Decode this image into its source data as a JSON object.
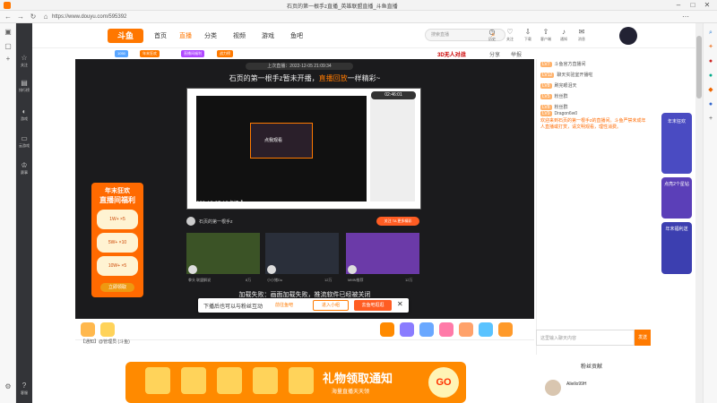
{
  "browser": {
    "title": "石页的第一根手z直播_英雄联盟直播_斗鱼直播",
    "url": "https://www.douyu.com/595392"
  },
  "site_sidebar": {
    "items": [
      {
        "icon": "star-icon",
        "label": "关注"
      },
      {
        "icon": "rank-icon",
        "label": "排行榜"
      },
      {
        "icon": "game-icon",
        "label": "游戏"
      },
      {
        "icon": "ticket-icon",
        "label": "云游戏"
      },
      {
        "icon": "trophy-icon",
        "label": "赛事"
      },
      {
        "icon": "help-icon",
        "label": "客服"
      }
    ]
  },
  "topnav": {
    "logo": "斗鱼",
    "links": [
      "首页",
      "直播",
      "分类",
      "视频",
      "游戏",
      "鱼吧"
    ],
    "active": "直播",
    "search_placeholder": "搜索直播",
    "tools": [
      {
        "icon": "history-icon",
        "label": "历史"
      },
      {
        "icon": "follow-icon",
        "label": "关注"
      },
      {
        "icon": "download-icon",
        "label": "下载"
      },
      {
        "icon": "upload-icon",
        "label": "客户端"
      },
      {
        "icon": "bell-icon",
        "label": "通知"
      },
      {
        "icon": "message-icon",
        "label": "消息"
      }
    ]
  },
  "anchor_bar": {
    "tags": [
      "1050",
      "年末狂欢",
      "直播间福利",
      "战力榜"
    ],
    "brand": "3D无人对战",
    "share": "分享",
    "report": "举报"
  },
  "player": {
    "last_live": "上次直播：2022-12-05 21:09:34",
    "offline_text": "石页的第一根手z暂未开播，",
    "offline_link": "直播回放",
    "offline_tail": "一样精彩~",
    "preview_date": "【 2022-12-05 18点场 】",
    "replay_label": "02:46:01",
    "cam_text": "点我观看",
    "anchor_name": "石页的第一根手z",
    "follow_btn": "关注 TA 更多精彩",
    "cards": [
      {
        "name": "拳头 联盟解说",
        "views": "8万"
      },
      {
        "name": "小小猪Du",
        "views": "12万"
      },
      {
        "name": "MMN推荐",
        "views": "12万"
      }
    ],
    "load_fail": "加载失败：画面加载失败，推流软件已经被关闭"
  },
  "promo_left": {
    "title1": "年末狂欢",
    "title2": "直播间福利",
    "rows": [
      "1W+ ×5",
      "5W+ ×10",
      "10W+ ×5"
    ],
    "cta": "立即领取"
  },
  "toast": {
    "message": "下播后也可以与粉丝互动",
    "link": "前往鱼吧",
    "btn1": "进入小组",
    "btn2": "去鱼吧逛逛"
  },
  "notice": "【通知】@管理员 (斗鱼)",
  "bottom_banner": {
    "title": "礼物领取通知",
    "subtitle": "海量直播天天领",
    "go": "GO"
  },
  "chat": {
    "items": [
      {
        "lv": "LV7",
        "text": "斗鱼官方直播间"
      },
      {
        "lv": "LV12",
        "text": "聊天实验室开播啦"
      },
      {
        "lv": "LV8",
        "text": "刷完眼泪天"
      },
      {
        "lv": "LV5",
        "text": "粉丝群"
      },
      {
        "lv": "LV8",
        "text": "粉丝群"
      },
      {
        "lv": "LV9",
        "text": "Dragon6w0"
      }
    ],
    "welcome": "欢迎来到石页的第一根手z的直播间。斗鱼严禁未成年人直播或打赏，请文明观看，理性消费。",
    "input_placeholder": "这里输入聊天内容",
    "send": "发送",
    "rank_title": "粉丝贡献",
    "rank_name": "Aliello99H"
  },
  "activity": [
    "年末狂欢",
    "点亮2个星钻",
    "年末福利送"
  ]
}
